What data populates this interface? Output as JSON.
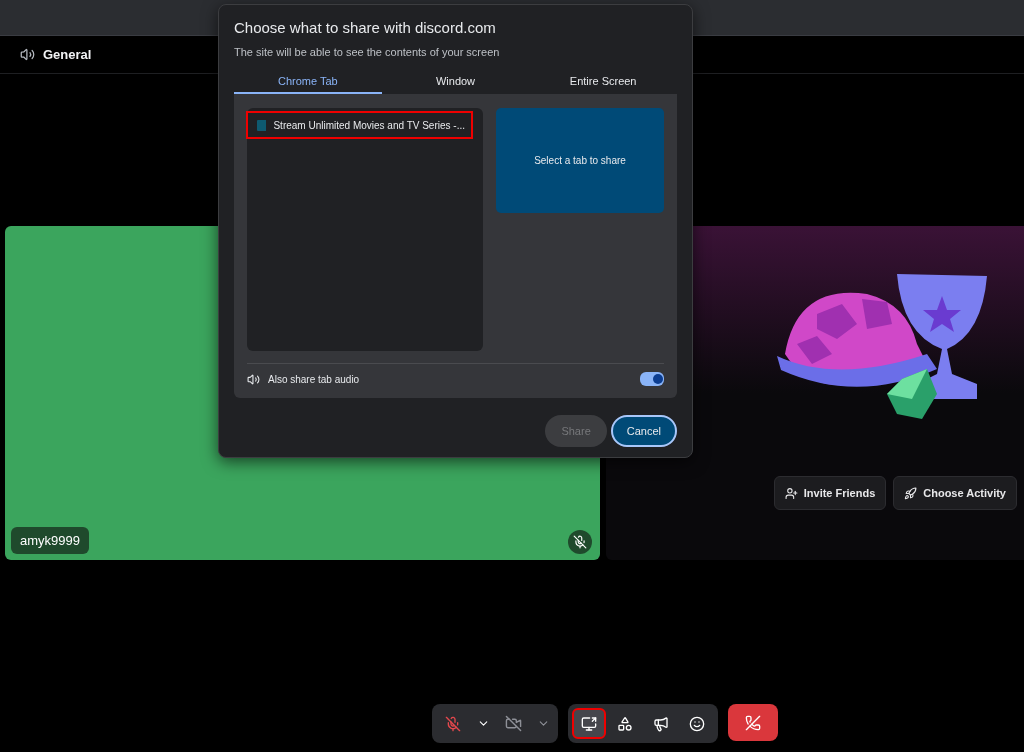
{
  "channel": {
    "name": "General"
  },
  "dialog": {
    "title": "Choose what to share with discord.com",
    "subtitle": "The site will be able to see the contents of your screen",
    "tabs": [
      {
        "label": "Chrome Tab",
        "selected": true
      },
      {
        "label": "Window",
        "selected": false
      },
      {
        "label": "Entire Screen",
        "selected": false
      }
    ],
    "tab_list": [
      {
        "title": "Stream Unlimited Movies and TV Series -...",
        "highlighted": true
      }
    ],
    "preview": {
      "text": "Select a tab to share"
    },
    "audio": {
      "label": "Also share tab audio",
      "on": true
    },
    "buttons": [
      {
        "label": "Share",
        "disabled": true
      },
      {
        "label": "Cancel",
        "disabled": false
      }
    ]
  },
  "user_tile": {
    "username": "amyk9999",
    "muted": true
  },
  "activity_tile": {
    "buttons": [
      {
        "label": "Invite Friends",
        "kind": "invite"
      },
      {
        "label": "Choose Activity",
        "kind": "activity"
      }
    ]
  },
  "controls": {
    "mic_muted": true,
    "camera_off": true,
    "actions": [
      {
        "kind": "screen-share",
        "selected": true,
        "highlighted": true
      },
      {
        "kind": "activities",
        "selected": false,
        "highlighted": false
      },
      {
        "kind": "soundboard",
        "selected": false,
        "highlighted": false
      },
      {
        "kind": "emoji",
        "selected": false,
        "highlighted": false
      }
    ]
  }
}
